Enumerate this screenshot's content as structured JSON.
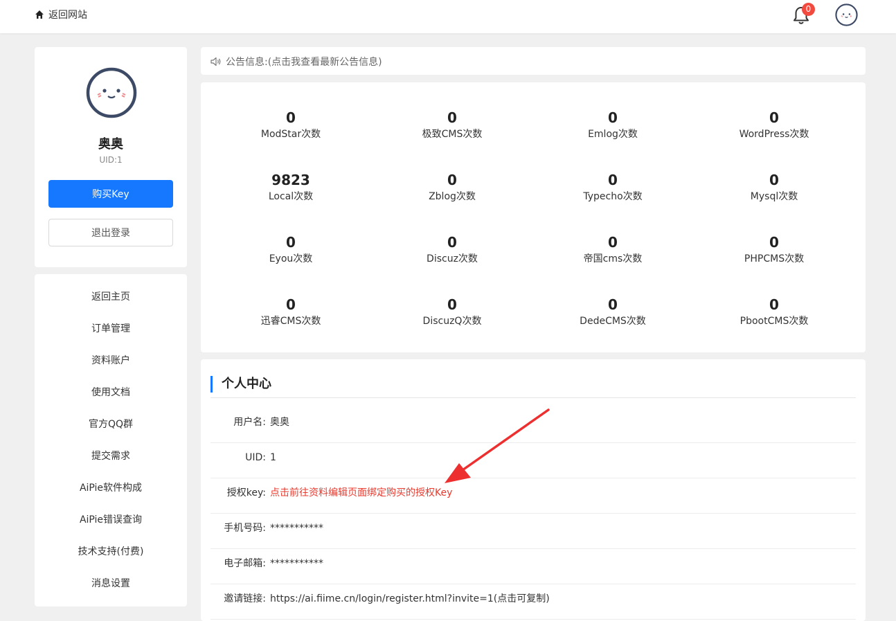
{
  "topbar": {
    "back_label": "返回网站",
    "notification_count": "0"
  },
  "profile": {
    "name": "奥奥",
    "uid_text": "UID:1",
    "buy_label": "购买Key",
    "logout_label": "退出登录"
  },
  "menu": {
    "items": [
      {
        "label": "返回主页"
      },
      {
        "label": "订单管理"
      },
      {
        "label": "资料账户"
      },
      {
        "label": "使用文档"
      },
      {
        "label": "官方QQ群"
      },
      {
        "label": "提交需求"
      },
      {
        "label": "AiPie软件构成"
      },
      {
        "label": "AiPie错误查询"
      },
      {
        "label": "技术支持(付费)"
      },
      {
        "label": "消息设置"
      }
    ]
  },
  "notice": {
    "text": "公告信息:(点击我查看最新公告信息)"
  },
  "stats": [
    {
      "value": "0",
      "label": "ModStar次数"
    },
    {
      "value": "0",
      "label": "极致CMS次数"
    },
    {
      "value": "0",
      "label": "Emlog次数"
    },
    {
      "value": "0",
      "label": "WordPress次数"
    },
    {
      "value": "9823",
      "label": "Local次数"
    },
    {
      "value": "0",
      "label": "Zblog次数"
    },
    {
      "value": "0",
      "label": "Typecho次数"
    },
    {
      "value": "0",
      "label": "Mysql次数"
    },
    {
      "value": "0",
      "label": "Eyou次数"
    },
    {
      "value": "0",
      "label": "Discuz次数"
    },
    {
      "value": "0",
      "label": "帝国cms次数"
    },
    {
      "value": "0",
      "label": "PHPCMS次数"
    },
    {
      "value": "0",
      "label": "迅睿CMS次数"
    },
    {
      "value": "0",
      "label": "DiscuzQ次数"
    },
    {
      "value": "0",
      "label": "DedeCMS次数"
    },
    {
      "value": "0",
      "label": "PbootCMS次数"
    }
  ],
  "personal": {
    "title": "个人中心",
    "rows": [
      {
        "label": "用户名:",
        "value": "奥奥"
      },
      {
        "label": "UID:",
        "value": "1"
      },
      {
        "label": "授权key:",
        "value": "点击前往资料编辑页面绑定购买的授权Key"
      },
      {
        "label": "手机号码:",
        "value": "***********"
      },
      {
        "label": "电子邮箱:",
        "value": "***********"
      },
      {
        "label": "邀请链接:",
        "value": "https://ai.fiime.cn/login/register.html?invite=1(点击可复制)"
      }
    ]
  },
  "colors": {
    "primary": "#1677ff",
    "alert_red": "#e83a2e",
    "badge_red": "#f24a3f"
  }
}
